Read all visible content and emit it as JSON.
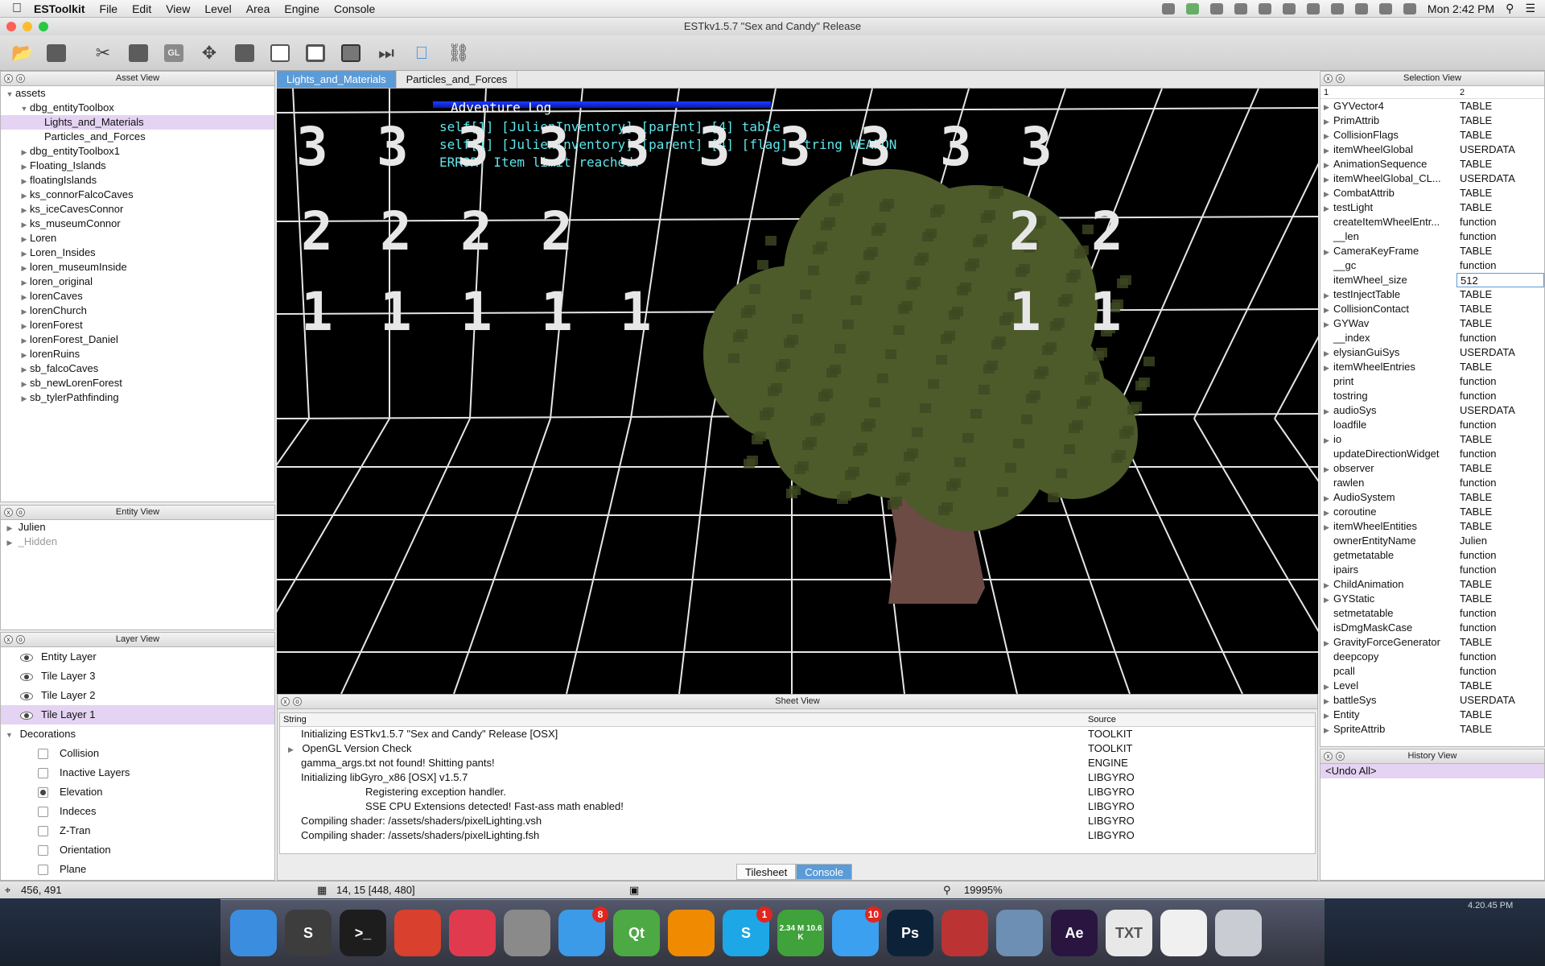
{
  "menubar": {
    "app_name": "ESToolkit",
    "menus": [
      "File",
      "Edit",
      "View",
      "Level",
      "Area",
      "Engine",
      "Console"
    ],
    "clock": "Mon 2:42 PM"
  },
  "window": {
    "title": "ESTkv1.5.7 \"Sex and Candy\" Release"
  },
  "toolbar": {
    "buttons": [
      "open-folder",
      "save",
      "cut",
      "clipboard",
      "gl",
      "move",
      "disk",
      "window",
      "screen",
      "stop",
      "step",
      "apple",
      "bridge"
    ],
    "gl_label": "GL"
  },
  "asset_view": {
    "title": "Asset View",
    "root": "assets",
    "items": [
      {
        "label": "dbg_entityToolbox",
        "level": 1,
        "expanded": true
      },
      {
        "label": "Lights_and_Materials",
        "level": 2,
        "selected": true
      },
      {
        "label": "Particles_and_Forces",
        "level": 2
      },
      {
        "label": "dbg_entityToolbox1",
        "level": 1
      },
      {
        "label": "Floating_Islands",
        "level": 1
      },
      {
        "label": "floatingIslands",
        "level": 1
      },
      {
        "label": "ks_connorFalcoCaves",
        "level": 1
      },
      {
        "label": "ks_iceCavesConnor",
        "level": 1
      },
      {
        "label": "ks_museumConnor",
        "level": 1
      },
      {
        "label": "Loren",
        "level": 1
      },
      {
        "label": "Loren_Insides",
        "level": 1
      },
      {
        "label": "loren_museumInside",
        "level": 1
      },
      {
        "label": "loren_original",
        "level": 1
      },
      {
        "label": "lorenCaves",
        "level": 1
      },
      {
        "label": "lorenChurch",
        "level": 1
      },
      {
        "label": "lorenForest",
        "level": 1
      },
      {
        "label": "lorenForest_Daniel",
        "level": 1
      },
      {
        "label": "lorenRuins",
        "level": 1
      },
      {
        "label": "sb_falcoCaves",
        "level": 1
      },
      {
        "label": "sb_newLorenForest",
        "level": 1
      },
      {
        "label": "sb_tylerPathfinding",
        "level": 1
      }
    ]
  },
  "entity_view": {
    "title": "Entity View",
    "items": [
      {
        "label": "Julien"
      },
      {
        "label": "_Hidden",
        "dim": true
      }
    ]
  },
  "layer_view": {
    "title": "Layer View",
    "layers": [
      "Entity Layer",
      "Tile Layer 3",
      "Tile Layer 2",
      "Tile Layer 1"
    ],
    "group": "Decorations",
    "options": [
      {
        "label": "Collision",
        "on": false
      },
      {
        "label": "Inactive Layers",
        "on": false
      },
      {
        "label": "Elevation",
        "on": true
      },
      {
        "label": "Indeces",
        "on": false
      },
      {
        "label": "Z-Tran",
        "on": false
      },
      {
        "label": "Orientation",
        "on": false
      },
      {
        "label": "Plane",
        "on": false
      }
    ]
  },
  "tabs": [
    "Lights_and_Materials",
    "Particles_and_Forces"
  ],
  "viewport": {
    "log_title": "Adventure Log",
    "log_lines": [
      "self[1] [JulienInventory] [parent] [4] table",
      "self[1] [JulienInventory] [parent] [4] [flag] string WEAPON",
      "ERROR: Item limit reached."
    ],
    "row_numbers": [
      "3",
      "2",
      "1"
    ],
    "colors": {
      "grid": "#e6e6e6",
      "foliage": "#4d5a2a",
      "trunk": "#6b4b44",
      "log_text": "#5ee6ec"
    }
  },
  "sheet_view": {
    "title": "Sheet View",
    "columns": [
      "String",
      "Source"
    ],
    "rows": [
      {
        "string": "Initializing ESTkv1.5.7 \"Sex and Candy\" Release [OSX]",
        "source": "TOOLKIT",
        "indent": 1
      },
      {
        "string": "OpenGL Version Check",
        "source": "TOOLKIT",
        "indent": 1,
        "arrow": true
      },
      {
        "string": "gamma_args.txt not found! Shitting pants!",
        "source": "ENGINE",
        "indent": 1
      },
      {
        "string": "Initializing libGyro_x86 [OSX] v1.5.7",
        "source": "LIBGYRO",
        "indent": 1
      },
      {
        "string": "Registering exception handler.",
        "source": "LIBGYRO",
        "indent": 2
      },
      {
        "string": "SSE CPU Extensions detected! Fast-ass math enabled!",
        "source": "LIBGYRO",
        "indent": 2
      },
      {
        "string": "Compiling shader: /assets/shaders/pixelLighting.vsh",
        "source": "LIBGYRO",
        "indent": 1
      },
      {
        "string": "Compiling shader: /assets/shaders/pixelLighting.fsh",
        "source": "LIBGYRO",
        "indent": 1
      }
    ],
    "tabs": [
      "Tilesheet",
      "Console"
    ]
  },
  "selection_view": {
    "title": "Selection View",
    "columns": [
      "1",
      "2"
    ],
    "rows": [
      {
        "k": "GYVector4",
        "v": "TABLE",
        "arrow": true
      },
      {
        "k": "PrimAttrib",
        "v": "TABLE",
        "arrow": true
      },
      {
        "k": "CollisionFlags",
        "v": "TABLE",
        "arrow": true
      },
      {
        "k": "itemWheelGlobal",
        "v": "USERDATA",
        "arrow": true
      },
      {
        "k": "AnimationSequence",
        "v": "TABLE",
        "arrow": true
      },
      {
        "k": "itemWheelGlobal_CL...",
        "v": "USERDATA",
        "arrow": true
      },
      {
        "k": "CombatAttrib",
        "v": "TABLE",
        "arrow": true
      },
      {
        "k": "testLight",
        "v": "TABLE",
        "arrow": true
      },
      {
        "k": "createItemWheelEntr...",
        "v": "function"
      },
      {
        "k": "__len",
        "v": "function"
      },
      {
        "k": "CameraKeyFrame",
        "v": "TABLE",
        "arrow": true
      },
      {
        "k": "__gc",
        "v": "function"
      },
      {
        "k": "itemWheel_size",
        "v": "512",
        "edit": true
      },
      {
        "k": "testInjectTable",
        "v": "TABLE",
        "arrow": true
      },
      {
        "k": "CollisionContact",
        "v": "TABLE",
        "arrow": true
      },
      {
        "k": "GYWav",
        "v": "TABLE",
        "arrow": true
      },
      {
        "k": "__index",
        "v": "function"
      },
      {
        "k": "elysianGuiSys",
        "v": "USERDATA",
        "arrow": true
      },
      {
        "k": "itemWheelEntries",
        "v": "TABLE",
        "arrow": true
      },
      {
        "k": "print",
        "v": "function"
      },
      {
        "k": "tostring",
        "v": "function"
      },
      {
        "k": "audioSys",
        "v": "USERDATA",
        "arrow": true
      },
      {
        "k": "loadfile",
        "v": "function"
      },
      {
        "k": "io",
        "v": "TABLE",
        "arrow": true
      },
      {
        "k": "updateDirectionWidget",
        "v": "function"
      },
      {
        "k": "observer",
        "v": "TABLE",
        "arrow": true
      },
      {
        "k": "rawlen",
        "v": "function"
      },
      {
        "k": "AudioSystem",
        "v": "TABLE",
        "arrow": true
      },
      {
        "k": "coroutine",
        "v": "TABLE",
        "arrow": true
      },
      {
        "k": "itemWheelEntities",
        "v": "TABLE",
        "arrow": true
      },
      {
        "k": "ownerEntityName",
        "v": "Julien"
      },
      {
        "k": "getmetatable",
        "v": "function"
      },
      {
        "k": "ipairs",
        "v": "function"
      },
      {
        "k": "ChildAnimation",
        "v": "TABLE",
        "arrow": true
      },
      {
        "k": "GYStatic",
        "v": "TABLE",
        "arrow": true
      },
      {
        "k": "setmetatable",
        "v": "function"
      },
      {
        "k": "isDmgMaskCase",
        "v": "function"
      },
      {
        "k": "GravityForceGenerator",
        "v": "TABLE",
        "arrow": true
      },
      {
        "k": "deepcopy",
        "v": "function"
      },
      {
        "k": "pcall",
        "v": "function"
      },
      {
        "k": "Level",
        "v": "TABLE",
        "arrow": true
      },
      {
        "k": "battleSys",
        "v": "USERDATA",
        "arrow": true
      },
      {
        "k": "Entity",
        "v": "TABLE",
        "arrow": true
      },
      {
        "k": "SpriteAttrib",
        "v": "TABLE",
        "arrow": true
      }
    ]
  },
  "history_view": {
    "title": "History View",
    "items": [
      "<Undo All>"
    ]
  },
  "status": {
    "cursor": "456, 491",
    "tile": "14, 15 [448, 480]",
    "zoom": "19995%"
  },
  "dock": {
    "apps": [
      {
        "name": "finder",
        "color": "#3b8de0"
      },
      {
        "name": "sublime",
        "color": "#3d3d3d",
        "text": "S"
      },
      {
        "name": "terminal",
        "color": "#1d1d1d",
        "text": ">_"
      },
      {
        "name": "chrome",
        "color": "#d9402e"
      },
      {
        "name": "itunes",
        "color": "#e03a4f"
      },
      {
        "name": "system-preferences",
        "color": "#8a8a8a"
      },
      {
        "name": "app-store",
        "color": "#3c9be8",
        "badge": "8"
      },
      {
        "name": "qt-creator",
        "color": "#4da944",
        "text": "Qt"
      },
      {
        "name": "vlc",
        "color": "#f08a00"
      },
      {
        "name": "skype",
        "color": "#1ea7e6",
        "text": "S",
        "badge": "1"
      },
      {
        "name": "utorrent",
        "color": "#3fa23a",
        "text": "2.34 M 10.6 K"
      },
      {
        "name": "messages",
        "color": "#3ca0f0",
        "badge": "10"
      },
      {
        "name": "photoshop",
        "color": "#0c2238",
        "text": "Ps"
      },
      {
        "name": "disc",
        "color": "#b33"
      },
      {
        "name": "anime-app",
        "color": "#6c8fb3"
      },
      {
        "name": "after-effects",
        "color": "#2a1540",
        "text": "Ae"
      },
      {
        "name": "document",
        "color": "#e8e8e8",
        "text": "TXT"
      },
      {
        "name": "calendar",
        "color": "#f0f0f0"
      },
      {
        "name": "trash",
        "color": "#c9cdd3"
      }
    ],
    "desktop_clock": "4.20.45 PM"
  }
}
